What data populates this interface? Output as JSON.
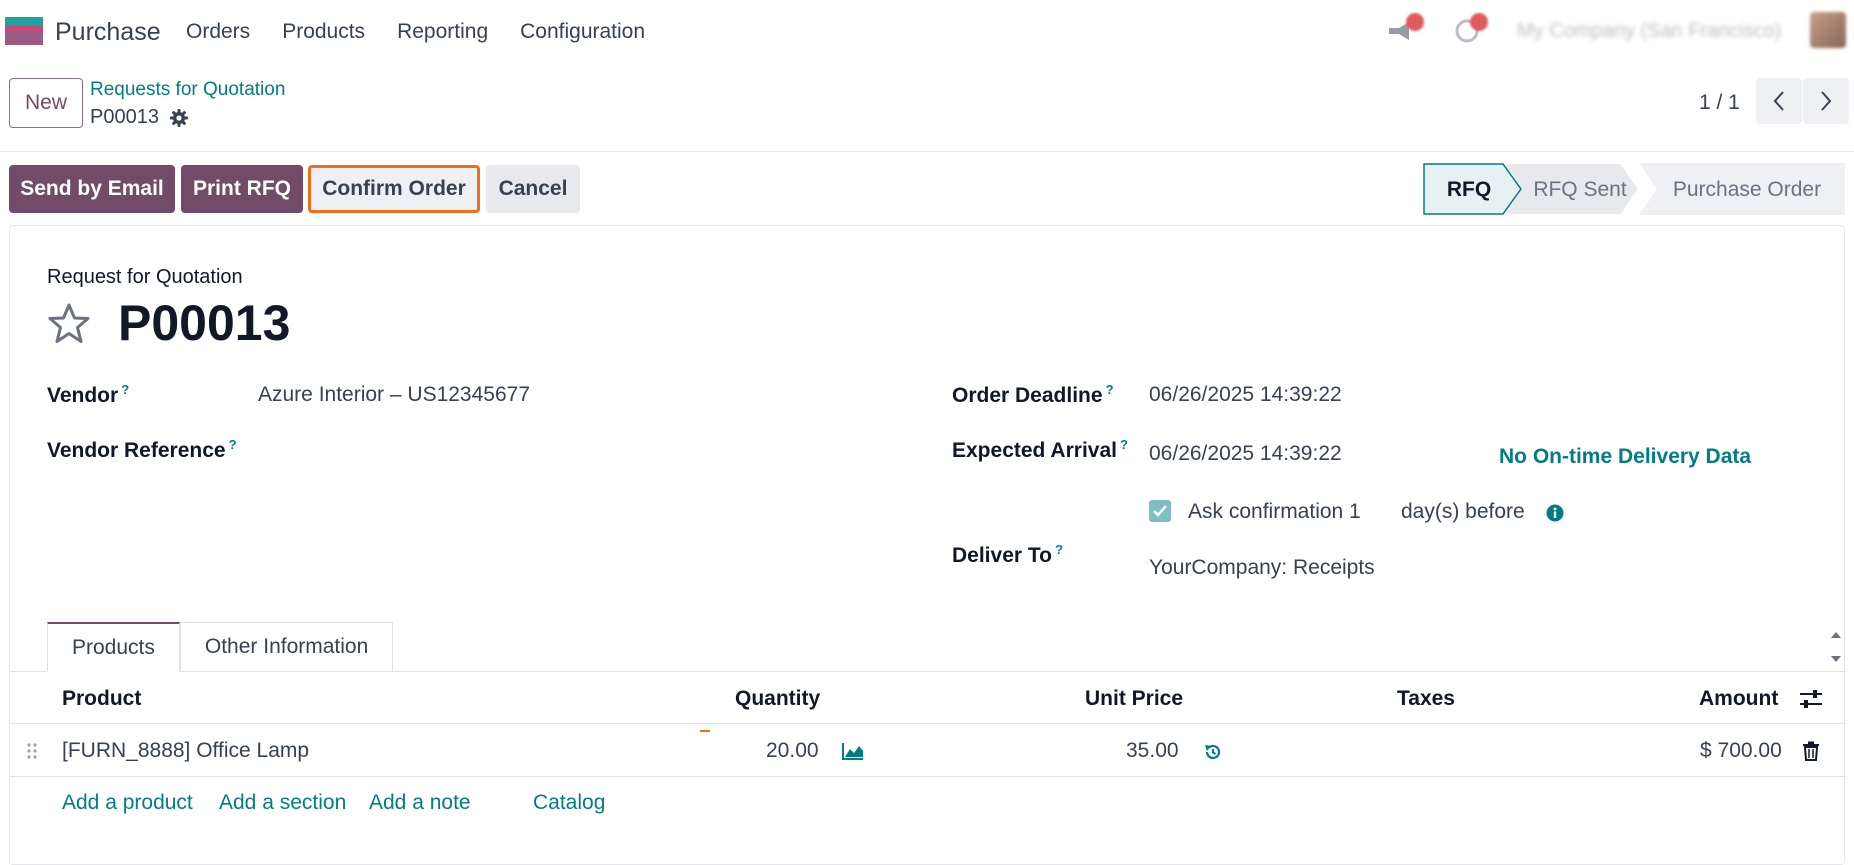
{
  "app": {
    "name": "Purchase",
    "menu": [
      "Orders",
      "Products",
      "Reporting",
      "Configuration"
    ],
    "company": "My Company (San Francisco)"
  },
  "control": {
    "new_label": "New",
    "breadcrumb_parent": "Requests for Quotation",
    "breadcrumb_current": "P00013",
    "pager": "1 / 1"
  },
  "actions": {
    "send_email": "Send by Email",
    "print_rfq": "Print RFQ",
    "confirm": "Confirm Order",
    "cancel": "Cancel"
  },
  "stages": [
    "RFQ",
    "RFQ Sent",
    "Purchase Order"
  ],
  "form": {
    "type_label": "Request for Quotation",
    "order_name": "P00013",
    "vendor_label": "Vendor",
    "vendor_value": "Azure Interior – US12345677",
    "vendor_ref_label": "Vendor Reference",
    "order_deadline_label": "Order Deadline",
    "order_deadline_value": "06/26/2025 14:39:22",
    "expected_arrival_label": "Expected Arrival",
    "expected_arrival_value": "06/26/2025 14:39:22",
    "on_time_label": "No On-time Delivery Data",
    "ask_confirmation_label": "Ask confirmation",
    "ask_confirmation_days": "1",
    "days_before_label": "day(s) before",
    "deliver_to_label": "Deliver To",
    "deliver_to_value": "YourCompany: Receipts",
    "help_mark": "?"
  },
  "tabs": [
    "Products",
    "Other Information"
  ],
  "table": {
    "headers": [
      "Product",
      "Quantity",
      "Unit Price",
      "Taxes",
      "Amount"
    ],
    "rows": [
      {
        "product": "[FURN_8888] Office Lamp",
        "quantity": "20.00",
        "unit_price": "35.00",
        "taxes": "",
        "amount": "$ 700.00"
      }
    ],
    "add_product": "Add a product",
    "add_section": "Add a section",
    "add_note": "Add a note",
    "catalog": "Catalog"
  },
  "colors": {
    "brand": "#714b67",
    "teal": "#017e84",
    "highlight": "#f06f1a"
  }
}
